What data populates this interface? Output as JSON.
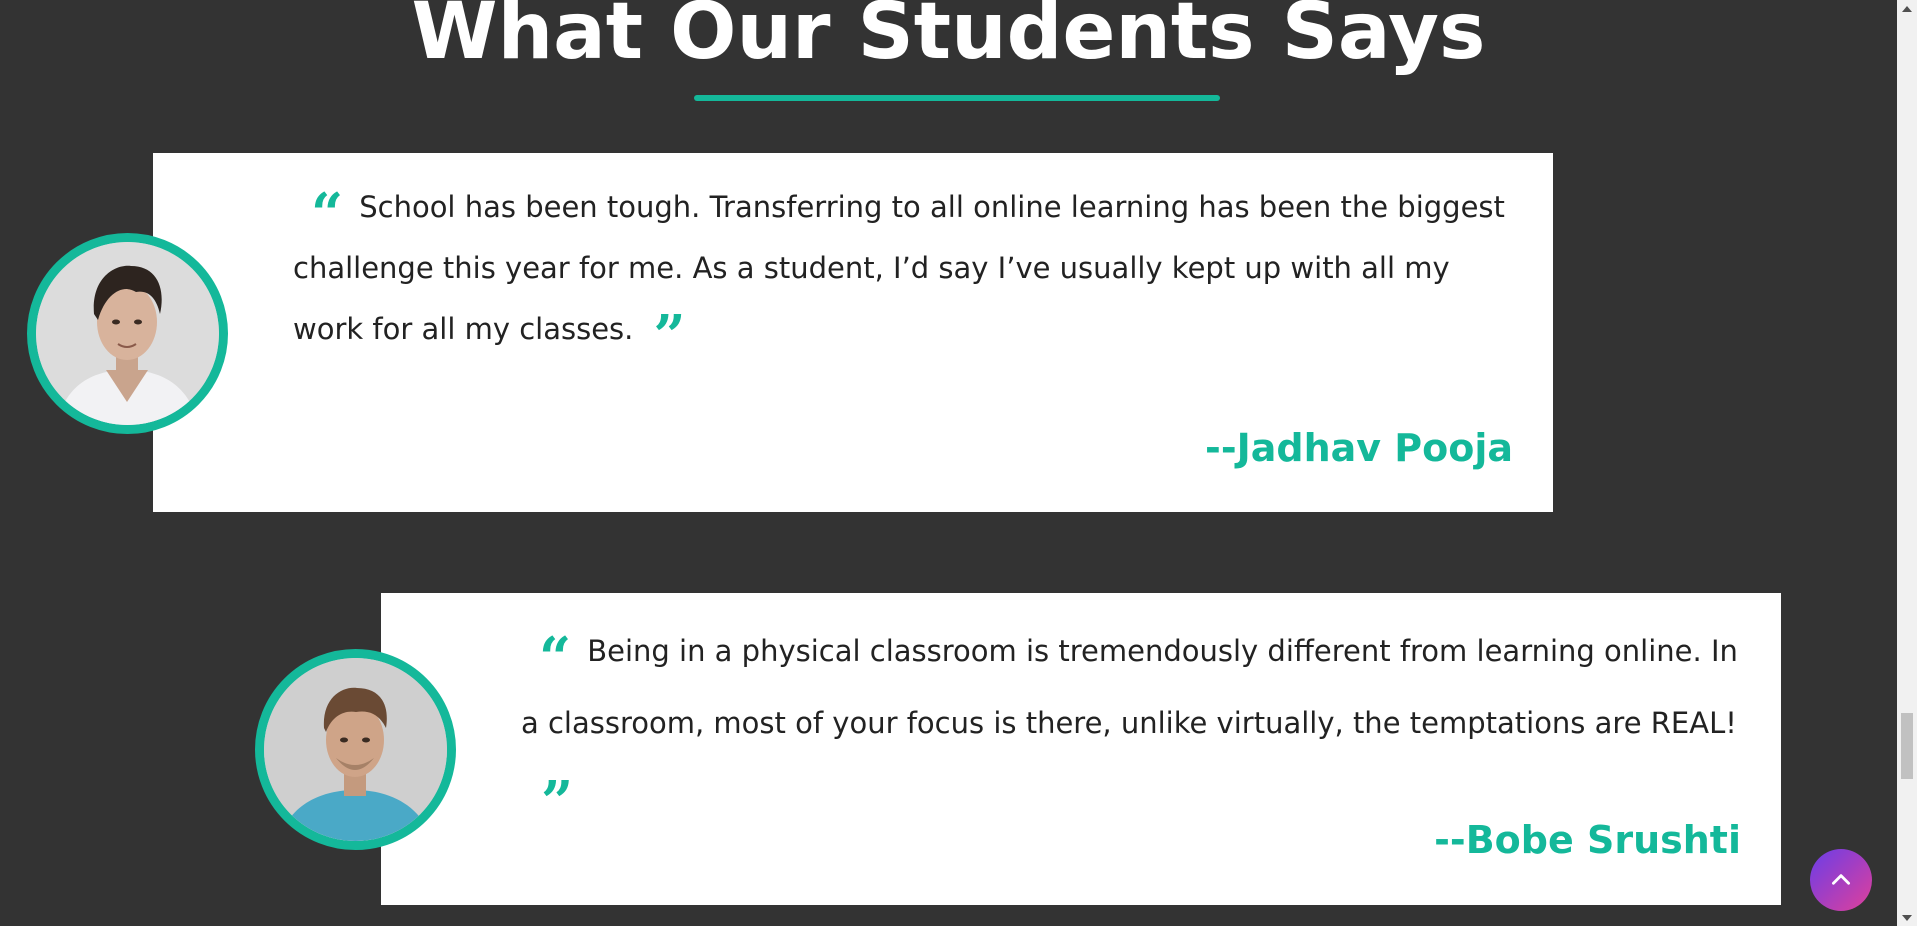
{
  "section": {
    "title": "What Our Students Says"
  },
  "colors": {
    "accent": "#14b89a",
    "background": "#333333",
    "card": "#ffffff",
    "scroll_button_gradient": [
      "#6a3de8",
      "#e0409a"
    ]
  },
  "icons": {
    "open_quote": "quote-left-icon",
    "close_quote": "quote-right-icon",
    "scroll_top": "chevron-up-icon"
  },
  "testimonials": [
    {
      "quote": "School has been tough. Transferring to all online learning has been the biggest challenge this year for me. As a student, I’d say I’ve usually kept up with all my work for all my classes.",
      "author": "--Jadhav Pooja"
    },
    {
      "quote": "Being in a physical classroom is tremendously different from learning online. In a classroom, most of your focus is there, unlike virtually, the temptations are REAL!",
      "author": "--Bobe Srushti"
    }
  ]
}
